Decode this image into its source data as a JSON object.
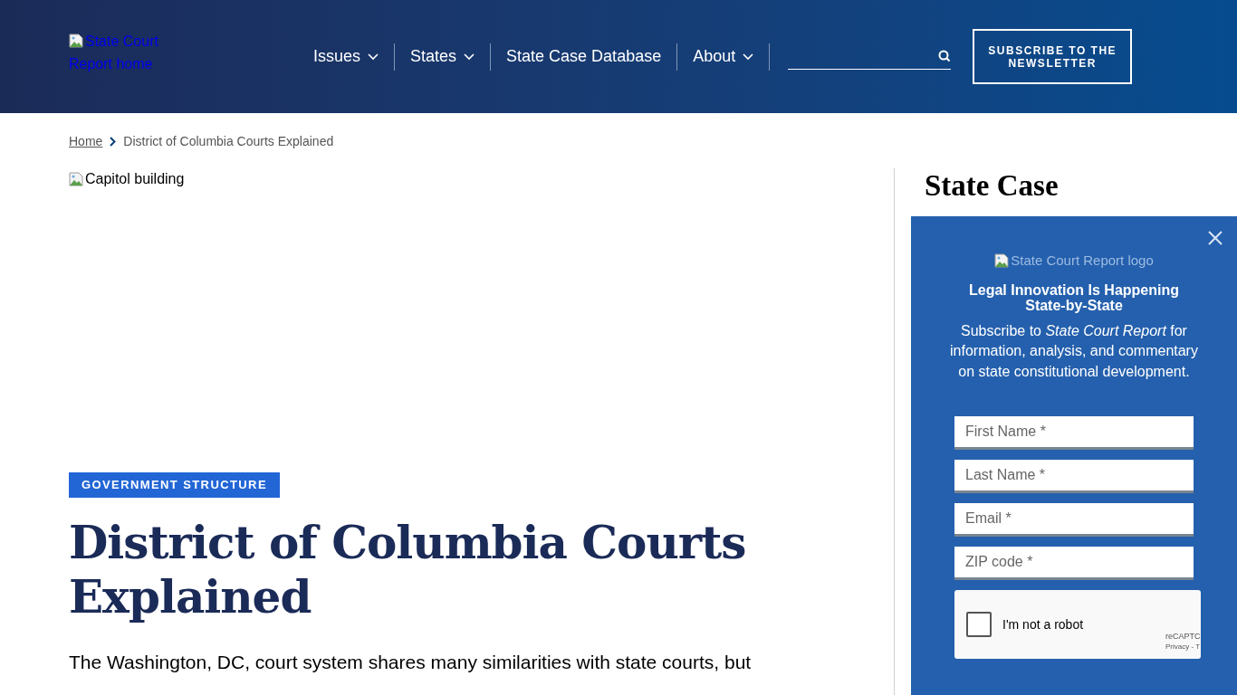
{
  "header": {
    "logo_alt": "State Court Report home",
    "nav": [
      {
        "label": "Issues",
        "dropdown": true
      },
      {
        "label": "States",
        "dropdown": true
      },
      {
        "label": "State Case Database",
        "dropdown": false
      },
      {
        "label": "About",
        "dropdown": true
      }
    ],
    "subscribe_button": "SUBSCRIBE TO THE NEWSLETTER"
  },
  "breadcrumb": [
    {
      "label": "Home",
      "link": true
    },
    {
      "label": "District of Columbia Courts Explained",
      "link": false
    }
  ],
  "article": {
    "image_alt": "Capitol building",
    "tag": "GOVERNMENT STRUCTURE",
    "title": "District of Columbia Courts Explained",
    "lede": "The Washington, DC, court system shares many similarities with state courts, but"
  },
  "sidebar": {
    "heading": "State Case"
  },
  "popup": {
    "logo_alt": "State Court Report logo",
    "heading": "Legal Innovation Is Happening State-by-State",
    "text": "Subscribe to *State Court Report* for information, analysis, and commentary on state constitutional development.",
    "fields": [
      {
        "placeholder": "First Name *"
      },
      {
        "placeholder": "Last Name *"
      },
      {
        "placeholder": "Email *"
      },
      {
        "placeholder": "ZIP code *"
      }
    ],
    "captcha": {
      "label": "I'm not a robot",
      "checked": false,
      "brand": "reCAPTC",
      "links": "Privacy - T"
    }
  }
}
